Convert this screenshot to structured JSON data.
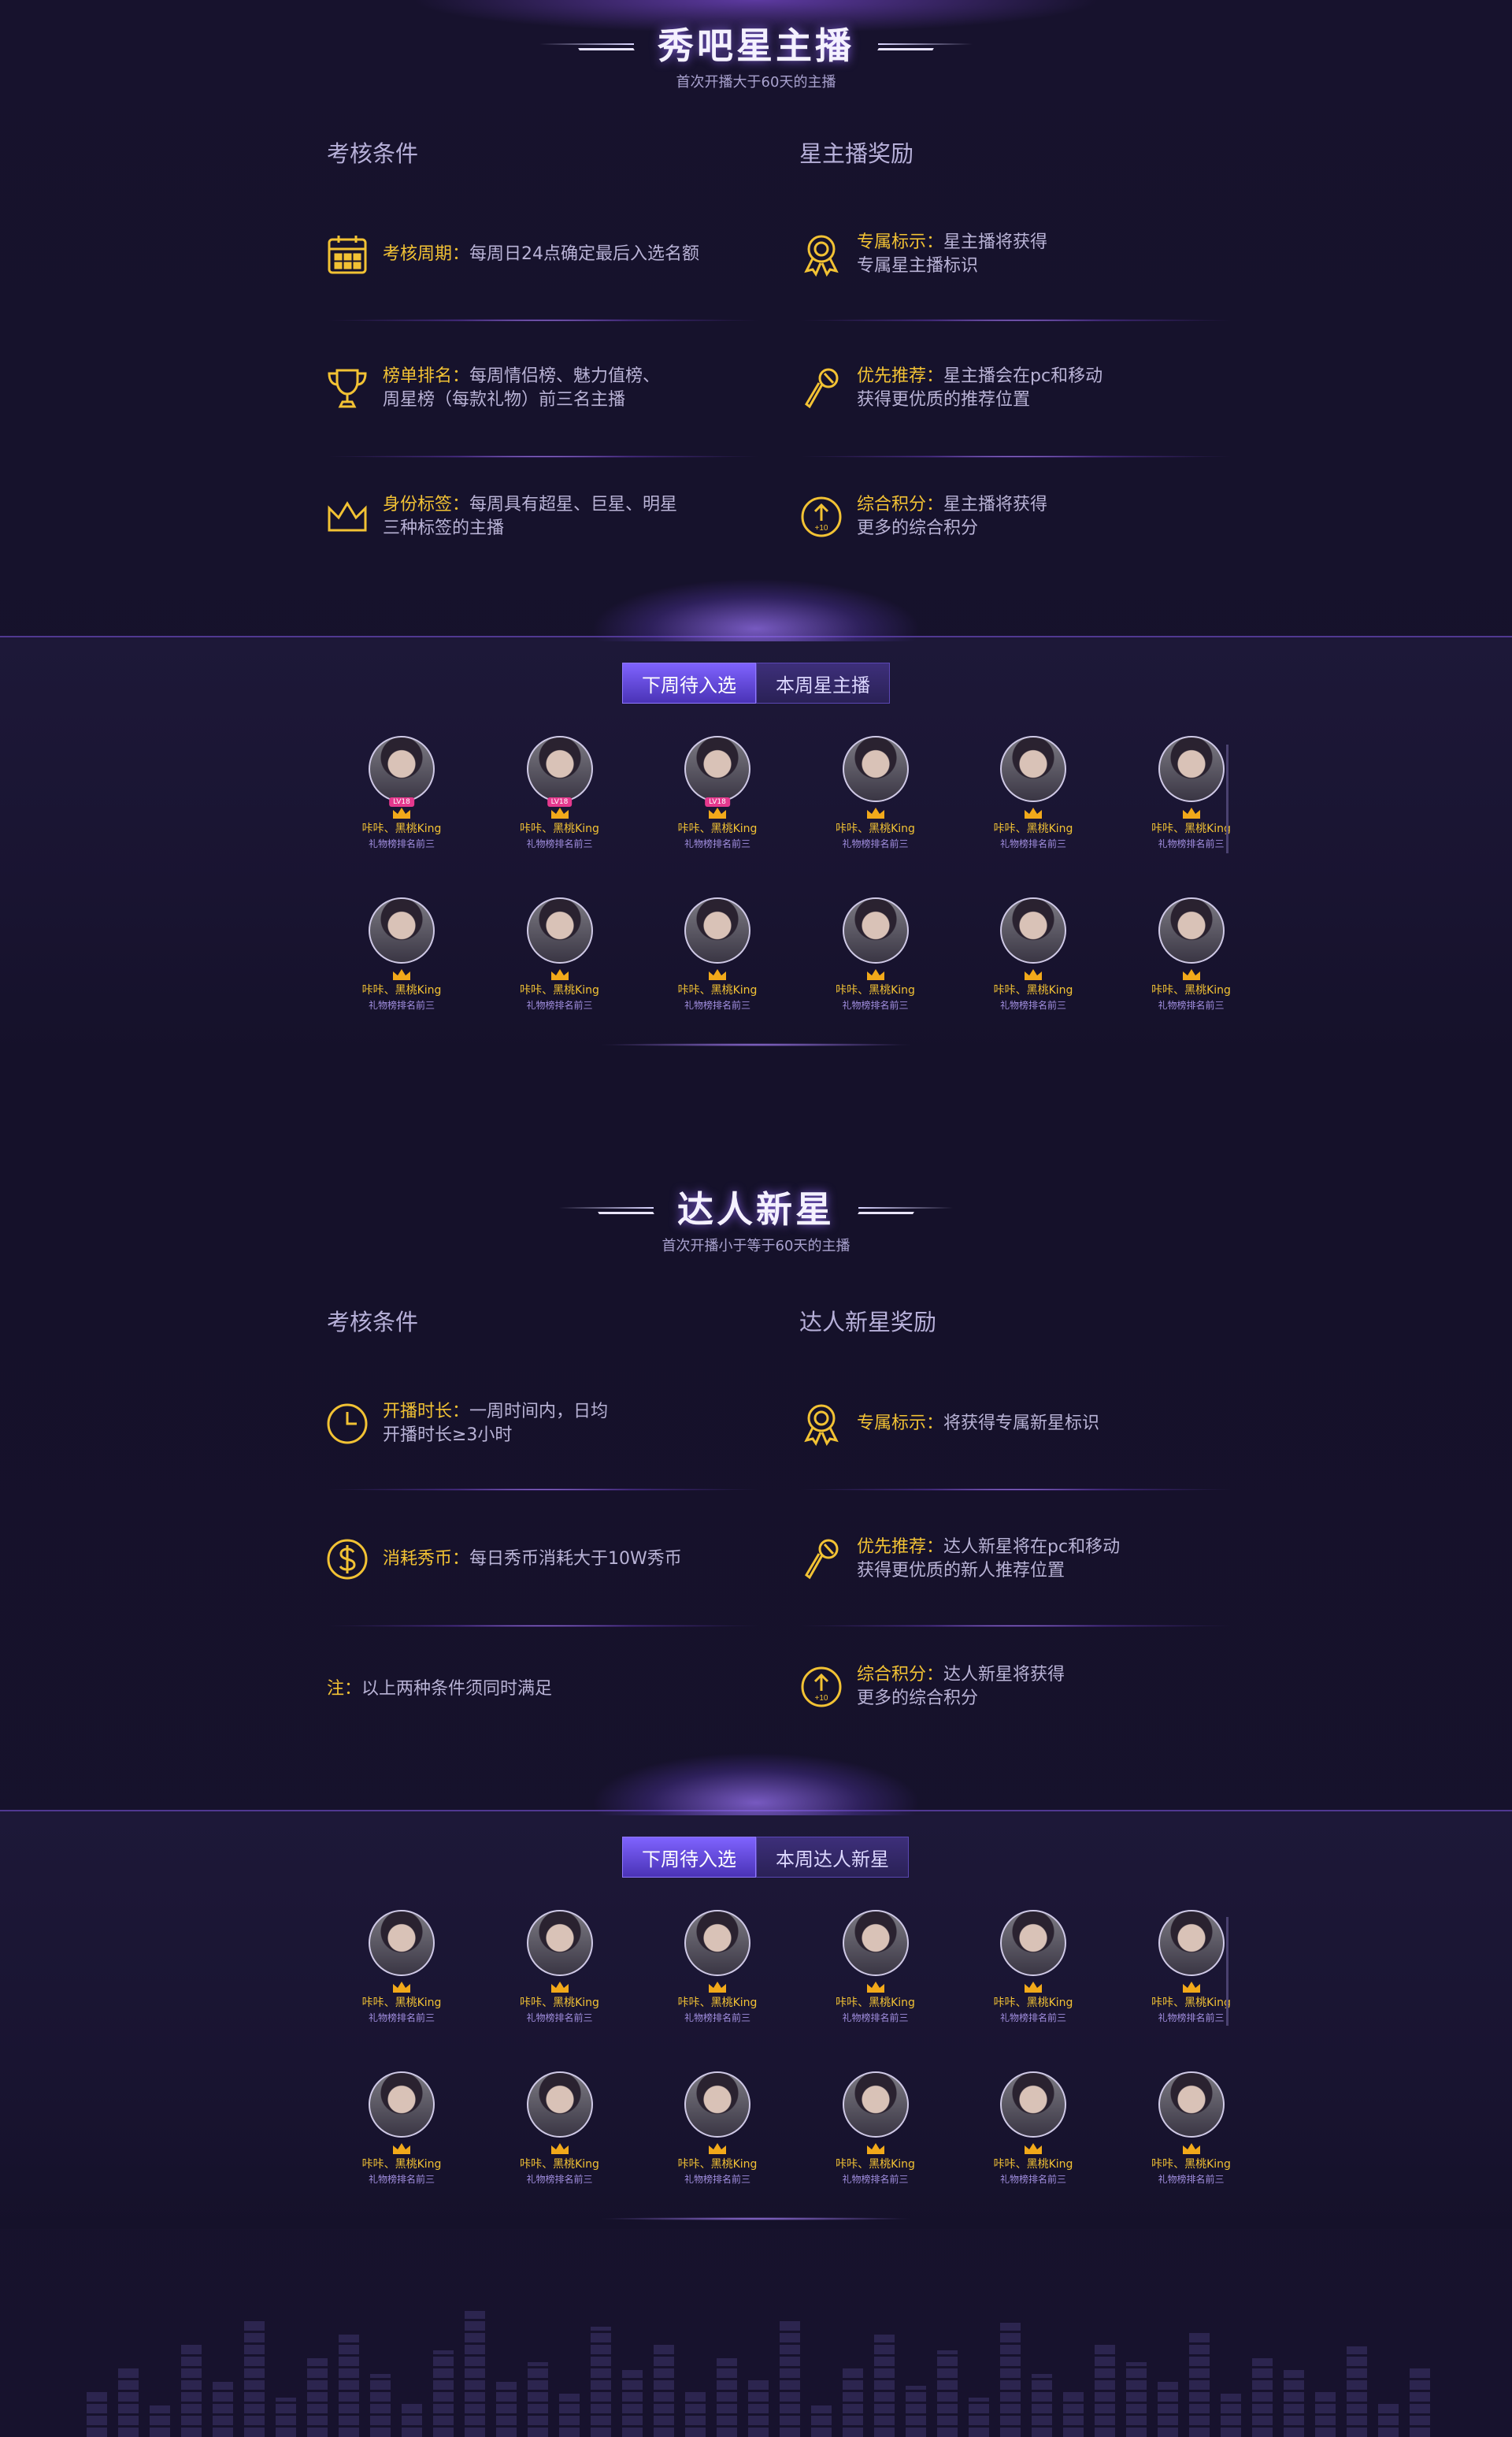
{
  "star": {
    "title": "秀吧星主播",
    "subtitle": "首次开播大于60天的主播",
    "left_head": "考核条件",
    "right_head": "星主播奖励",
    "left_items": [
      {
        "key": "考核周期：",
        "text": "每周日24点确定最后入选名额",
        "icon": "calendar-icon"
      },
      {
        "key": "榜单排名：",
        "text": "每周情侣榜、魅力值榜、\n周星榜（每款礼物）前三名主播",
        "icon": "trophy-icon"
      },
      {
        "key": "身份标签：",
        "text": "每周具有超星、巨星、明星\n三种标签的主播",
        "icon": "crown-icon"
      }
    ],
    "right_items": [
      {
        "key": "专属标示：",
        "text": "星主播将获得\n专属星主播标识",
        "icon": "medal-icon"
      },
      {
        "key": "优先推荐：",
        "text": "星主播会在pc和移动\n获得更优质的推荐位置",
        "icon": "microphone-icon"
      },
      {
        "key": "综合积分：",
        "text": "星主播将获得\n更多的综合积分",
        "icon": "points-up-icon"
      }
    ],
    "tabs": [
      "下周待入选",
      "本周星主播"
    ],
    "anchors": [
      {
        "name": "咔咔、黑桃King",
        "rank": "礼物榜排名前三",
        "level": "LV18"
      },
      {
        "name": "咔咔、黑桃King",
        "rank": "礼物榜排名前三",
        "level": "LV18"
      },
      {
        "name": "咔咔、黑桃King",
        "rank": "礼物榜排名前三",
        "level": "LV18"
      },
      {
        "name": "咔咔、黑桃King",
        "rank": "礼物榜排名前三",
        "level": ""
      },
      {
        "name": "咔咔、黑桃King",
        "rank": "礼物榜排名前三",
        "level": ""
      },
      {
        "name": "咔咔、黑桃King",
        "rank": "礼物榜排名前三",
        "level": ""
      },
      {
        "name": "咔咔、黑桃King",
        "rank": "礼物榜排名前三",
        "level": ""
      },
      {
        "name": "咔咔、黑桃King",
        "rank": "礼物榜排名前三",
        "level": ""
      },
      {
        "name": "咔咔、黑桃King",
        "rank": "礼物榜排名前三",
        "level": ""
      },
      {
        "name": "咔咔、黑桃King",
        "rank": "礼物榜排名前三",
        "level": ""
      },
      {
        "name": "咔咔、黑桃King",
        "rank": "礼物榜排名前三",
        "level": ""
      },
      {
        "name": "咔咔、黑桃King",
        "rank": "礼物榜排名前三",
        "level": ""
      }
    ]
  },
  "newstar": {
    "title": "达人新星",
    "subtitle": "首次开播小于等于60天的主播",
    "left_head": "考核条件",
    "right_head": "达人新星奖励",
    "left_items": [
      {
        "key": "开播时长：",
        "text": "一周时间内，日均\n开播时长≥3小时",
        "icon": "clock-icon"
      },
      {
        "key": "消耗秀币：",
        "text": "每日秀币消耗大于10W秀币",
        "icon": "dollar-coin-icon"
      }
    ],
    "note_key": "注：",
    "note_text": "以上两种条件须同时满足",
    "right_items": [
      {
        "key": "专属标示：",
        "text": "将获得专属新星标识",
        "icon": "medal-icon"
      },
      {
        "key": "优先推荐：",
        "text": "达人新星将在pc和移动\n获得更优质的新人推荐位置",
        "icon": "microphone-icon"
      },
      {
        "key": "综合积分：",
        "text": "达人新星将获得\n更多的综合积分",
        "icon": "points-up-icon"
      }
    ],
    "tabs": [
      "下周待入选",
      "本周达人新星"
    ],
    "anchors": [
      {
        "name": "咔咔、黑桃King",
        "rank": "礼物榜排名前三",
        "level": ""
      },
      {
        "name": "咔咔、黑桃King",
        "rank": "礼物榜排名前三",
        "level": ""
      },
      {
        "name": "咔咔、黑桃King",
        "rank": "礼物榜排名前三",
        "level": ""
      },
      {
        "name": "咔咔、黑桃King",
        "rank": "礼物榜排名前三",
        "level": ""
      },
      {
        "name": "咔咔、黑桃King",
        "rank": "礼物榜排名前三",
        "level": ""
      },
      {
        "name": "咔咔、黑桃King",
        "rank": "礼物榜排名前三",
        "level": ""
      },
      {
        "name": "咔咔、黑桃King",
        "rank": "礼物榜排名前三",
        "level": ""
      },
      {
        "name": "咔咔、黑桃King",
        "rank": "礼物榜排名前三",
        "level": ""
      },
      {
        "name": "咔咔、黑桃King",
        "rank": "礼物榜排名前三",
        "level": ""
      },
      {
        "name": "咔咔、黑桃King",
        "rank": "礼物榜排名前三",
        "level": ""
      },
      {
        "name": "咔咔、黑桃King",
        "rank": "礼物榜排名前三",
        "level": ""
      },
      {
        "name": "咔咔、黑桃King",
        "rank": "礼物榜排名前三",
        "level": ""
      }
    ]
  },
  "colors": {
    "accent_gold": "#f2c234",
    "accent_purple": "#7f63ff",
    "background": "#15112a"
  }
}
